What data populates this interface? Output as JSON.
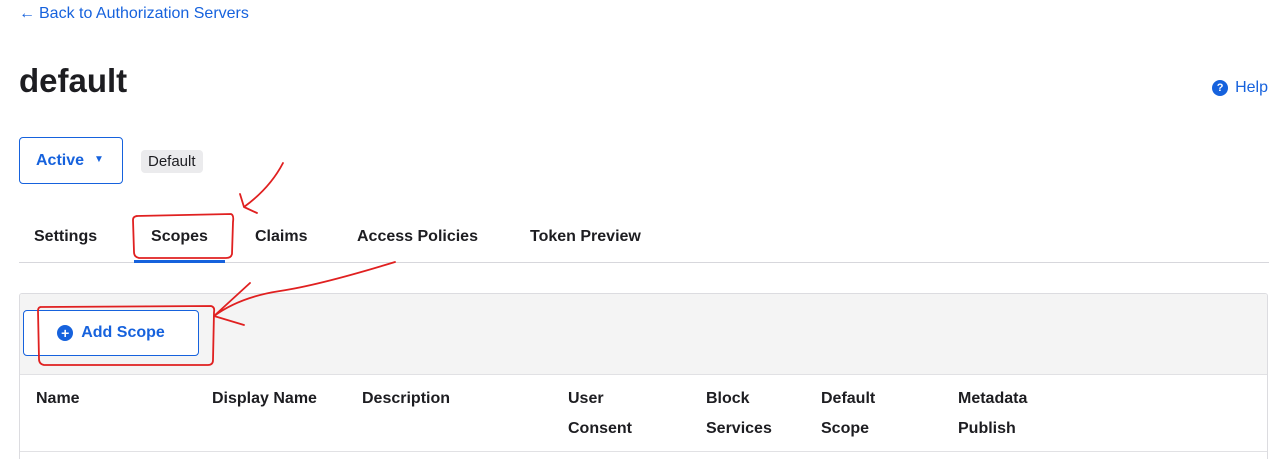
{
  "nav": {
    "back_arrow": "←",
    "back_label": "Back to Authorization Servers"
  },
  "header": {
    "title": "default",
    "help_icon": "?",
    "help_label": "Help"
  },
  "status": {
    "selected": "Active",
    "caret": "▼",
    "badge": "Default"
  },
  "tabs": [
    {
      "label": "Settings"
    },
    {
      "label": "Scopes",
      "active": true
    },
    {
      "label": "Claims"
    },
    {
      "label": "Access Policies"
    },
    {
      "label": "Token Preview"
    }
  ],
  "toolbar": {
    "add_icon": "+",
    "add_label": "Add Scope"
  },
  "table": {
    "columns": [
      {
        "line1": "Name",
        "line2": ""
      },
      {
        "line1": "Display Name",
        "line2": ""
      },
      {
        "line1": "Description",
        "line2": ""
      },
      {
        "line1": "User",
        "line2": "Consent"
      },
      {
        "line1": "Block",
        "line2": "Services"
      },
      {
        "line1": "Default",
        "line2": "Scope"
      },
      {
        "line1": "Metadata",
        "line2": "Publish"
      }
    ]
  },
  "colors": {
    "accent": "#1662dd",
    "annotation": "#e02020"
  }
}
